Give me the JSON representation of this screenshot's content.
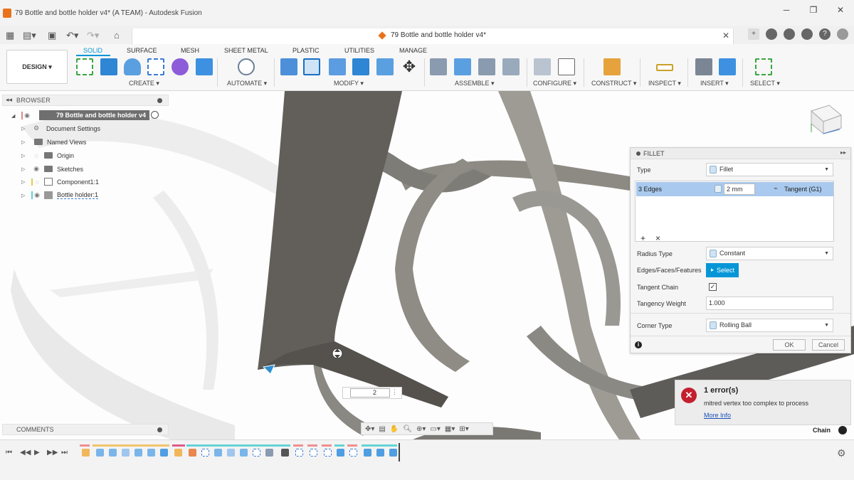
{
  "window": {
    "title": "79 Bottle and bottle holder v4* (A TEAM) - Autodesk Fusion",
    "controls": [
      "─",
      "❐",
      "✕"
    ]
  },
  "document": {
    "tab_title": "79 Bottle and bottle holder v4*",
    "close": "✕"
  },
  "ribbon": {
    "workspace": "DESIGN ▾",
    "tabs": [
      "SOLID",
      "SURFACE",
      "MESH",
      "SHEET METAL",
      "PLASTIC",
      "UTILITIES",
      "MANAGE"
    ],
    "groups": [
      "CREATE ▾",
      "AUTOMATE ▾",
      "MODIFY ▾",
      "ASSEMBLE ▾",
      "CONFIGURE ▾",
      "CONSTRUCT ▾",
      "INSPECT ▾",
      "INSERT ▾",
      "SELECT ▾"
    ]
  },
  "browser": {
    "title": "BROWSER",
    "root": "79 Bottle and bottle holder v4",
    "items": [
      {
        "label": "Document Settings"
      },
      {
        "label": "Named Views"
      },
      {
        "label": "Origin"
      },
      {
        "label": "Sketches"
      },
      {
        "label": "Component1:1"
      },
      {
        "label": "Bottle holder:1"
      }
    ]
  },
  "comments": {
    "title": "COMMENTS"
  },
  "fillet": {
    "title": "FILLET",
    "type_label": "Type",
    "type_value": "Fillet",
    "edges_label": "3 Edges",
    "radius_value": "2 mm",
    "continuity": "Tangent (G1)",
    "radius_type_label": "Radius Type",
    "radius_type_value": "Constant",
    "edges_faces_label": "Edges/Faces/Features",
    "select_label": "Select",
    "tangent_chain_label": "Tangent Chain",
    "tangency_weight_label": "Tangency Weight",
    "tangency_weight_value": "1.000",
    "corner_type_label": "Corner Type",
    "corner_type_value": "Rolling Ball",
    "ok_label": "OK",
    "cancel_label": "Cancel"
  },
  "error": {
    "heading": "1 error(s)",
    "message": "mitred vertex too complex to process",
    "more_info": "More Info"
  },
  "canvas_input": {
    "value": "2"
  },
  "status": {
    "chain_label": "Chain"
  },
  "colors": {
    "accent": "#0696d7",
    "model": "#6e6c68",
    "error": "#c3202e",
    "selection_row": "#a9c9ee"
  }
}
